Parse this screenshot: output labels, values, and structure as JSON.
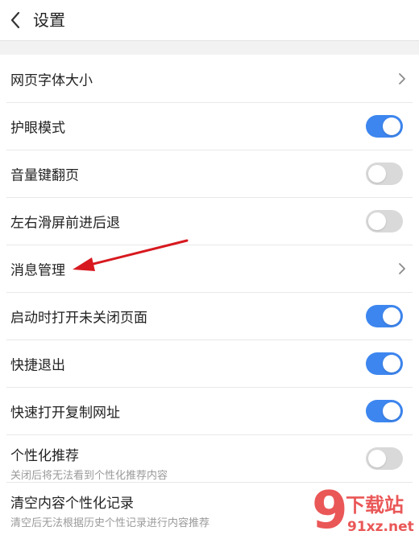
{
  "header": {
    "title": "设置"
  },
  "rows": [
    {
      "label": "网页字体大小",
      "control": "chevron"
    },
    {
      "label": "护眼模式",
      "control": "toggle",
      "on": true
    },
    {
      "label": "音量键翻页",
      "control": "toggle",
      "on": false
    },
    {
      "label": "左右滑屏前进后退",
      "control": "toggle",
      "on": false
    },
    {
      "label": "消息管理",
      "control": "chevron"
    },
    {
      "label": "启动时打开未关闭页面",
      "control": "toggle",
      "on": true
    },
    {
      "label": "快捷退出",
      "control": "toggle",
      "on": true
    },
    {
      "label": "快速打开复制网址",
      "control": "toggle",
      "on": true
    },
    {
      "label": "个性化推荐",
      "sub": "关闭后将无法看到个性化推荐内容",
      "control": "toggle",
      "on": false
    },
    {
      "label": "清空内容个性化记录",
      "sub": "清空后无法根据历史个性记录进行内容推荐",
      "control": "none"
    }
  ],
  "watermark": {
    "logo_text": "9",
    "brand": "下载站",
    "domain": "91xz.net"
  },
  "colors": {
    "toggle_on": "#3d86ef",
    "toggle_off": "#d9d9d9",
    "annotation_arrow": "#d7191f",
    "watermark": "#e84545"
  }
}
